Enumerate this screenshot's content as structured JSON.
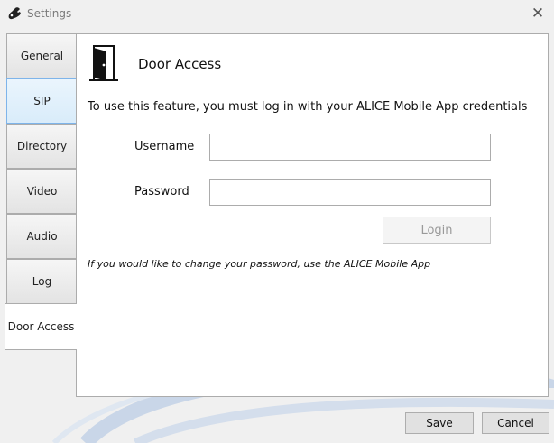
{
  "window": {
    "title": "Settings"
  },
  "tabs": [
    {
      "label": "General",
      "state": "normal"
    },
    {
      "label": "SIP",
      "state": "hover"
    },
    {
      "label": "Directory",
      "state": "normal"
    },
    {
      "label": "Video",
      "state": "normal"
    },
    {
      "label": "Audio",
      "state": "normal"
    },
    {
      "label": "Log",
      "state": "normal"
    },
    {
      "label": "Door Access",
      "state": "selected"
    }
  ],
  "panel": {
    "title": "Door Access",
    "intro": "To use this feature, you must log in with your ALICE Mobile App credentials",
    "username_label": "Username",
    "username_value": "",
    "password_label": "Password",
    "password_value": "",
    "login_label": "Login",
    "note": "If you would like to change your password, use the ALICE Mobile App"
  },
  "footer": {
    "save_label": "Save",
    "cancel_label": "Cancel"
  },
  "icons": {
    "app": "phone-handset-icon",
    "close": "close-icon",
    "door": "open-door-icon"
  },
  "colors": {
    "accent_border": "#7eb4ea",
    "swoosh": "#c9d6e8"
  }
}
